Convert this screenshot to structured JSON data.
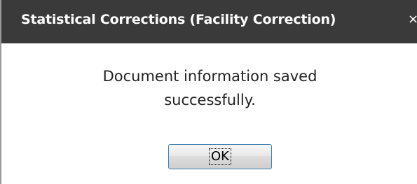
{
  "dialog": {
    "title": "Statistical Corrections (Facility Correction)",
    "close_glyph": "×",
    "message_line1": "Document information saved",
    "message_line2": "successfully.",
    "ok_label": "OK"
  },
  "colors": {
    "titlebar_bg": "#3a3a3a",
    "titlebar_text": "#ffffff",
    "button_border": "#3c7fb1"
  },
  "icons": {
    "close": "close-icon"
  }
}
